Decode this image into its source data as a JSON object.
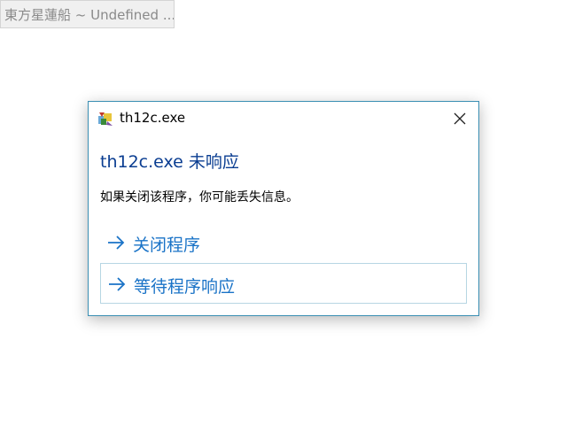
{
  "taskbar": {
    "label": "東方星蓮船 ~ Undefined ..."
  },
  "dialog": {
    "title": "th12c.exe",
    "heading": "th12c.exe 未响应",
    "message": "如果关闭该程序，你可能丢失信息。",
    "commands": [
      {
        "label": "关闭程序"
      },
      {
        "label": "等待程序响应"
      }
    ],
    "icons": {
      "app": "app-icon",
      "close": "close-icon",
      "command_arrow": "arrow-right-icon"
    },
    "colors": {
      "heading": "#0a3d91",
      "command": "#1a73c7",
      "border": "#3b8fb3"
    }
  }
}
